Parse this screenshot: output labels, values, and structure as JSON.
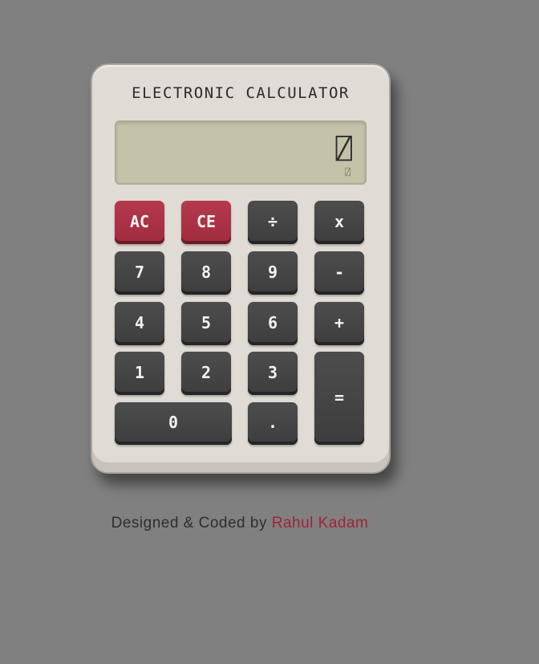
{
  "calculator": {
    "title": "ELECTRONIC CALCULATOR",
    "display": {
      "value": "⍁",
      "history": "⍁"
    },
    "keys": {
      "ac": "AC",
      "ce": "CE",
      "divide": "÷",
      "multiply": "x",
      "seven": "7",
      "eight": "8",
      "nine": "9",
      "minus": "-",
      "four": "4",
      "five": "5",
      "six": "6",
      "plus": "+",
      "one": "1",
      "two": "2",
      "three": "3",
      "equals": "=",
      "zero": "0",
      "decimal": "."
    }
  },
  "credit": {
    "prefix": "Designed & Coded by ",
    "author": "Rahul Kadam"
  },
  "colors": {
    "page_background": "#808080",
    "calculator_body": "#e0dbd4",
    "display_background": "#c4c3a8",
    "key_dark": "#444444",
    "key_red": "#ad3044",
    "author_accent": "#9e2435"
  }
}
